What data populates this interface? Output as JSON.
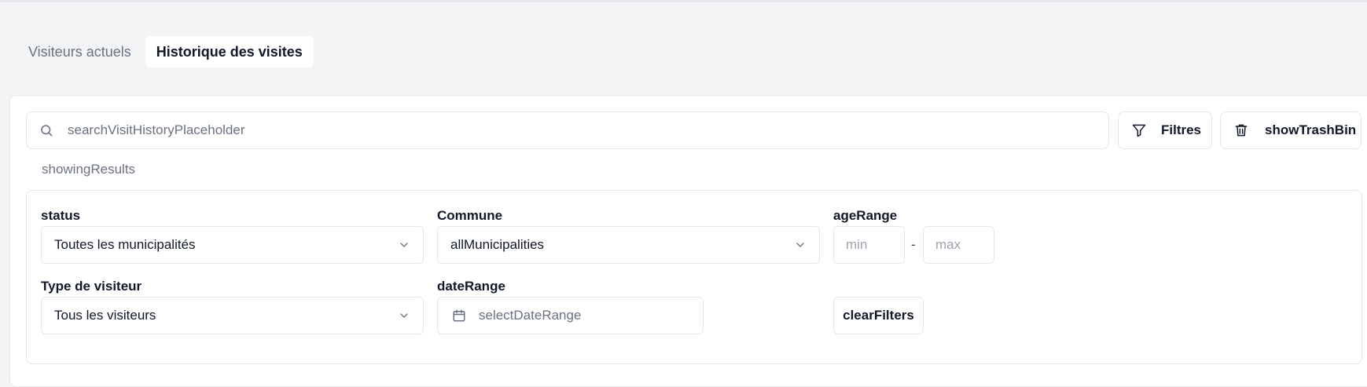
{
  "tabs": [
    {
      "label": "Visiteurs actuels",
      "active": false
    },
    {
      "label": "Historique des visites",
      "active": true
    }
  ],
  "search": {
    "placeholder": "searchVisitHistoryPlaceholder",
    "value": "",
    "icon": "search-icon"
  },
  "toolbar": {
    "filters_label": "Filtres",
    "filters_icon": "filter-icon",
    "trash_label": "showTrashBin",
    "trash_icon": "trash-icon"
  },
  "results_text": "showingResults",
  "filters": {
    "status": {
      "label": "status",
      "value": "Toutes les municipalités"
    },
    "commune": {
      "label": "Commune",
      "value": "allMunicipalities"
    },
    "age_range": {
      "label": "ageRange",
      "min_placeholder": "min",
      "max_placeholder": "max",
      "separator": "-"
    },
    "visitor_type": {
      "label": "Type de visiteur",
      "value": "Tous les visiteurs"
    },
    "date_range": {
      "label": "dateRange",
      "placeholder": "selectDateRange",
      "icon": "calendar-icon"
    },
    "clear_label": "clearFilters"
  },
  "colors": {
    "background": "#f3f4f6",
    "panel": "#ffffff",
    "border": "#e5e7eb",
    "muted_text": "#6b7280"
  }
}
